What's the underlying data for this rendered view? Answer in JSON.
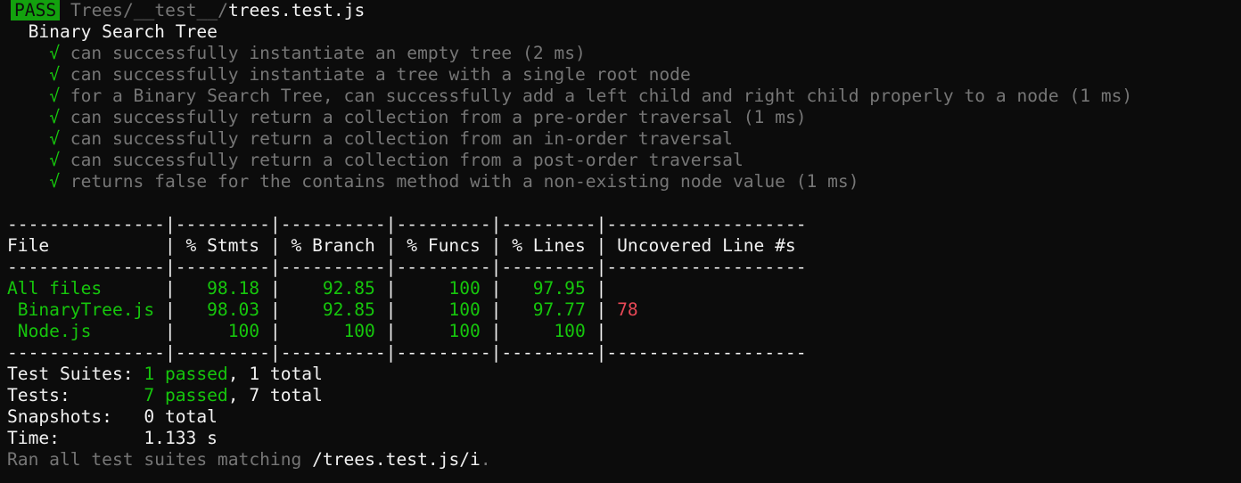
{
  "header": {
    "badge": "PASS",
    "path_dim": "Trees/__test__/",
    "path_file": "trees.test.js"
  },
  "suite": {
    "name": "Binary Search Tree",
    "check_glyph": "√",
    "tests": [
      "can successfully instantiate an empty tree (2 ms)",
      "can successfully instantiate a tree with a single root node",
      "for a Binary Search Tree, can successfully add a left child and right child properly to a node (1 ms)",
      "can successfully return a collection from a pre-order traversal (1 ms)",
      "can successfully return a collection from an in-order traversal",
      "can successfully return a collection from a post-order traversal",
      "returns false for the contains method with a non-existing node value (1 ms)"
    ]
  },
  "coverage": {
    "separator": "---------------|---------|----------|---------|---------|-------------------",
    "headers": [
      "File",
      "% Stmts",
      "% Branch",
      "% Funcs",
      "% Lines",
      "Uncovered Line #s"
    ],
    "rows": [
      {
        "file": "All files",
        "stmts": "98.18",
        "branch": "92.85",
        "funcs": "100",
        "lines": "97.95",
        "uncovered": ""
      },
      {
        "file": " BinaryTree.js",
        "stmts": "98.03",
        "branch": "92.85",
        "funcs": "100",
        "lines": "97.77",
        "uncovered": "78"
      },
      {
        "file": " Node.js",
        "stmts": "100",
        "branch": "100",
        "funcs": "100",
        "lines": "100",
        "uncovered": ""
      }
    ]
  },
  "summary": {
    "suites_label": "Test Suites:",
    "suites_passed": "1 passed",
    "suites_total": ", 1 total",
    "tests_label": "Tests:",
    "tests_passed": "7 passed",
    "tests_total": ", 7 total",
    "snapshots_label": "Snapshots:",
    "snapshots_value": "0 total",
    "time_label": "Time:",
    "time_value": "1.133 s",
    "ran_prefix": "Ran all test suites matching ",
    "ran_pattern": "/trees.test.js/i",
    "ran_suffix": "."
  }
}
